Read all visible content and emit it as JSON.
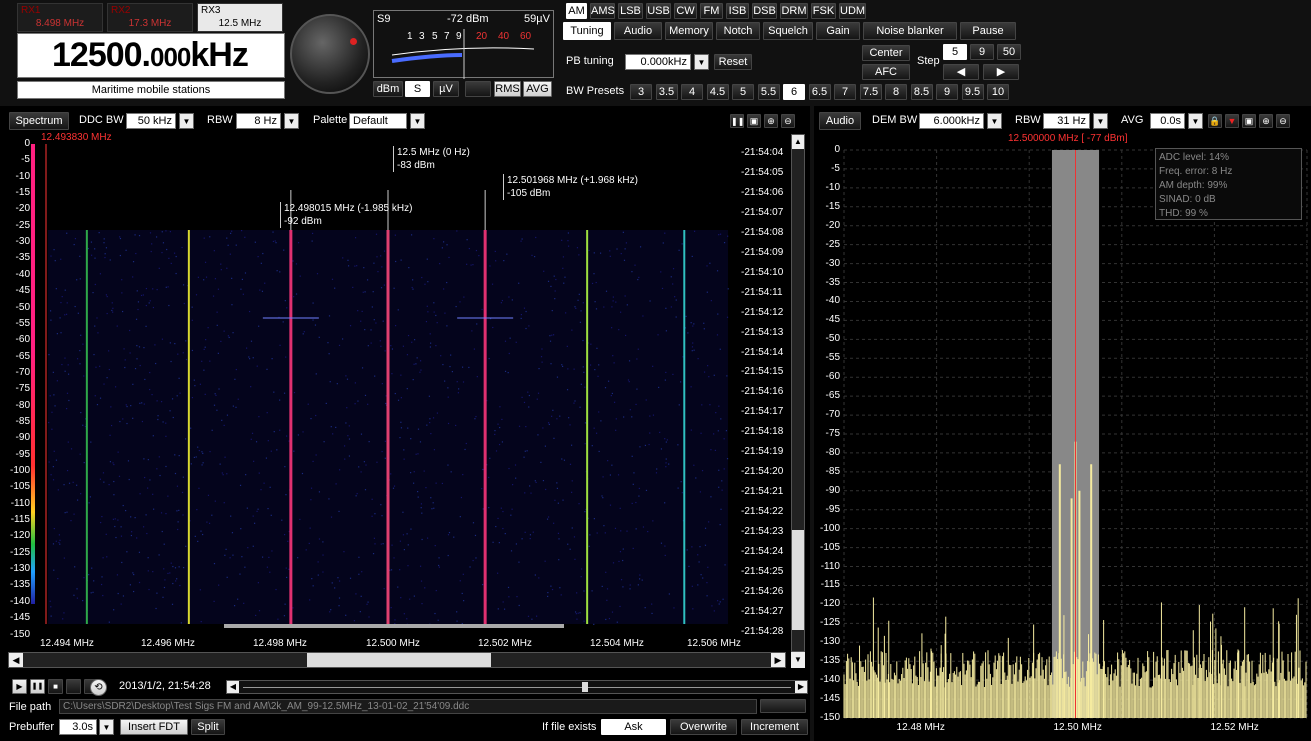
{
  "receivers": [
    {
      "name": "RX1",
      "freq": "8.498 MHz"
    },
    {
      "name": "RX2",
      "freq": "17.3 MHz"
    },
    {
      "name": "RX3",
      "freq": "12.5 MHz"
    }
  ],
  "frequency": {
    "main": "12500.",
    "fraction": "000",
    "unit": "kHz"
  },
  "band_name": "Maritime mobile stations",
  "meter": {
    "s_label": "S9",
    "level": "-72 dBm",
    "uv": "59µV",
    "scale": [
      "1",
      "3",
      "5",
      "7",
      "9",
      "20",
      "40",
      "60"
    ],
    "buttons": [
      "dBm",
      "S",
      "µV",
      "",
      "RMS",
      "AVG"
    ]
  },
  "modes": [
    "AM",
    "AMS",
    "LSB",
    "USB",
    "CW",
    "FM",
    "ISB",
    "DSB",
    "DRM",
    "FSK",
    "UDM"
  ],
  "selected_mode": "AM",
  "tabs": [
    "Tuning",
    "Audio",
    "Memory",
    "Notch",
    "Squelch",
    "Gain",
    "Noise blanker",
    "Pause"
  ],
  "pb_tuning": {
    "label": "PB tuning",
    "value": "0.000kHz",
    "reset": "Reset"
  },
  "center": "Center",
  "afc": "AFC",
  "step": {
    "label": "Step",
    "values": [
      "5",
      "9",
      "50"
    ],
    "left": "◀",
    "right": "▶"
  },
  "bw_presets": {
    "label": "BW Presets",
    "values": [
      "3",
      "3.5",
      "4",
      "4.5",
      "5",
      "5.5",
      "6",
      "6.5",
      "7",
      "7.5",
      "8",
      "8.5",
      "9",
      "9.5",
      "10"
    ],
    "selected": "6"
  },
  "spectrum": {
    "tab": "Spectrum",
    "ddc_bw_label": "DDC BW",
    "ddc_bw": "50 kHz",
    "rbw_label": "RBW",
    "rbw": "8 Hz",
    "palette_label": "Palette",
    "palette": "Default",
    "cursor_freq": "12.493830 MHz",
    "y_ticks": [
      "0",
      "-5",
      "-10",
      "-15",
      "-20",
      "-25",
      "-30",
      "-35",
      "-40",
      "-45",
      "-50",
      "-55",
      "-60",
      "-65",
      "-70",
      "-75",
      "-80",
      "-85",
      "-90",
      "-95",
      "-100",
      "-105",
      "-110",
      "-115",
      "-120",
      "-125",
      "-130",
      "-135",
      "-140",
      "-145",
      "-150"
    ],
    "x_ticks": [
      "12.494 MHz",
      "12.496 MHz",
      "12.498 MHz",
      "12.500 MHz",
      "12.502 MHz",
      "12.504 MHz",
      "12.506 MHz"
    ],
    "times": [
      "-21:54:04",
      "-21:54:05",
      "-21:54:06",
      "-21:54:07",
      "-21:54:08",
      "-21:54:09",
      "-21:54:10",
      "-21:54:11",
      "-21:54:12",
      "-21:54:13",
      "-21:54:14",
      "-21:54:15",
      "-21:54:16",
      "-21:54:17",
      "-21:54:18",
      "-21:54:19",
      "-21:54:20",
      "-21:54:21",
      "-21:54:22",
      "-21:54:23",
      "-21:54:24",
      "-21:54:25",
      "-21:54:26",
      "-21:54:27",
      "-21:54:28"
    ],
    "markers": [
      {
        "freq": "12.5 MHz (0 Hz)",
        "level": "-83 dBm"
      },
      {
        "freq": "12.501968 MHz (+1.968 kHz)",
        "level": "-105 dBm"
      },
      {
        "freq": "12.498015 MHz (-1.985 kHz)",
        "level": "-92 dBm"
      }
    ],
    "lines": [
      {
        "f": 12.4938,
        "color": "#2ea84a"
      },
      {
        "f": 12.4959,
        "color": "#d8d830"
      },
      {
        "f": 12.498,
        "color": "#e03070"
      },
      {
        "f": 12.5,
        "color": "#e04070"
      },
      {
        "f": 12.502,
        "color": "#e03070"
      },
      {
        "f": 12.5041,
        "color": "#9ee040"
      },
      {
        "f": 12.5061,
        "color": "#30c0c0"
      }
    ]
  },
  "audio": {
    "tab": "Audio",
    "dem_bw_label": "DEM BW",
    "dem_bw": "6.000kHz",
    "rbw_label": "RBW",
    "rbw": "31 Hz",
    "avg_label": "AVG",
    "avg": "0.0s",
    "cursor": "12.500000 MHz [  -77 dBm]",
    "y_ticks": [
      "0",
      "-5",
      "-10",
      "-15",
      "-20",
      "-25",
      "-30",
      "-35",
      "-40",
      "-45",
      "-50",
      "-55",
      "-60",
      "-65",
      "-70",
      "-75",
      "-80",
      "-85",
      "-90",
      "-95",
      "-100",
      "-105",
      "-110",
      "-115",
      "-120",
      "-125",
      "-130",
      "-135",
      "-140",
      "-145",
      "-150"
    ],
    "x_ticks": [
      "12.48 MHz",
      "12.50 MHz",
      "12.52 MHz"
    ],
    "stats": [
      "ADC level: 14%",
      "Freq. error: 8 Hz",
      "AM depth: 99%",
      "SINAD: 0 dB",
      "THD: 99 %"
    ]
  },
  "chart_data": {
    "type": "bar",
    "x_range_mhz": [
      12.4705,
      12.5295
    ],
    "ylim": [
      -150,
      0
    ],
    "xlabel": "",
    "ylabel": "",
    "series": [
      {
        "values": [
          {
            "f": 12.5,
            "db": -77
          },
          {
            "f": 12.498,
            "db": -83
          },
          {
            "f": 12.502,
            "db": -83
          },
          {
            "f": 12.4995,
            "db": -92
          },
          {
            "f": 12.5005,
            "db": -90
          }
        ]
      }
    ]
  },
  "player": {
    "timestamp": "2013/1/2, 21:54:28",
    "file_path_label": "File path",
    "file_path": "C:\\Users\\SDR2\\Desktop\\Test Sigs FM and AM\\2k_AM_99-12.5MHz_13-01-02_21'54'09.ddc",
    "prebuffer_label": "Prebuffer",
    "prebuffer": "3.0s",
    "insert_fdt": "Insert FDT",
    "split": "Split",
    "if_exists_label": "If file exists",
    "options": [
      "Ask",
      "Overwrite",
      "Increment"
    ]
  }
}
